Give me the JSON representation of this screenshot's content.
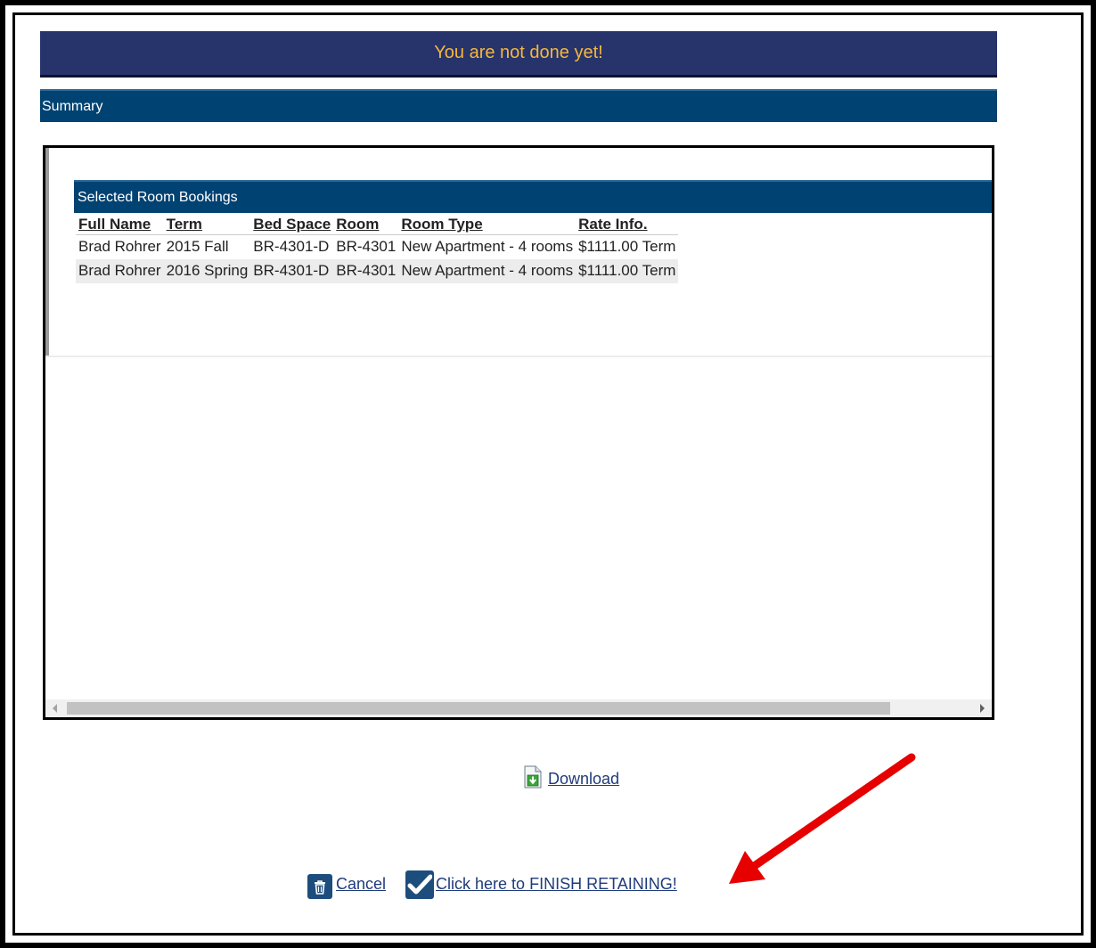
{
  "header": {
    "banner_text": "You are not done yet!"
  },
  "summary": {
    "title": "Summary"
  },
  "bookings": {
    "title": "Selected Room Bookings",
    "columns": [
      "Full Name",
      "Term",
      "Bed Space",
      "Room",
      "Room Type",
      "Rate Info."
    ],
    "rows": [
      [
        "Brad Rohrer",
        "2015 Fall",
        "BR-4301-D",
        "BR-4301",
        "New Apartment - 4 rooms",
        "$1111.00 Term"
      ],
      [
        "Brad Rohrer",
        "2016 Spring",
        "BR-4301-D",
        "BR-4301",
        "New Apartment - 4 rooms",
        "$1111.00 Term"
      ]
    ]
  },
  "actions": {
    "download_label": "Download",
    "cancel_label": "Cancel",
    "finish_label": "Click here to FINISH RETAINING!"
  },
  "colors": {
    "banner_bg": "#27336b",
    "banner_text": "#f6b73c",
    "section_bg": "#004272",
    "link": "#1f3b7a",
    "annotation_arrow": "#e60000"
  },
  "icons": [
    "download-icon",
    "trash-icon",
    "checkmark-icon",
    "annotation-arrow"
  ]
}
